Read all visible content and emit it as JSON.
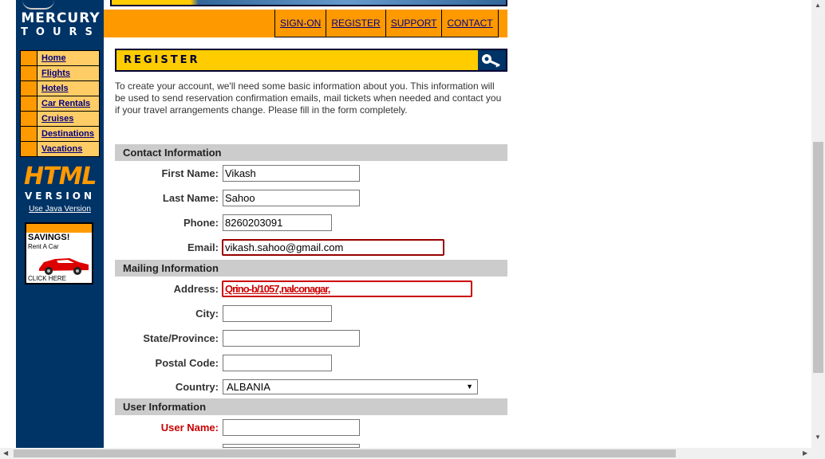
{
  "brand": {
    "line1": "MERCURY",
    "line2": "TOURS"
  },
  "nav": {
    "items": [
      "Home",
      "Flights",
      "Hotels",
      "Car Rentals",
      "Cruises",
      "Destinations",
      "Vacations"
    ]
  },
  "side": {
    "html_label": "HTML",
    "version_label": "VERSION",
    "java_link": "Use Java Version",
    "ad": {
      "title": "SAVINGS!",
      "subtitle": "Rent A Car",
      "cta": "CLICK HERE"
    }
  },
  "toplinks": [
    "SIGN-ON",
    "REGISTER",
    "SUPPORT",
    "CONTACT"
  ],
  "page": {
    "title": "REGISTER",
    "intro": "To create your account, we'll need some basic information about you. This information will be used to send reservation confirmation emails, mail tickets when needed and contact you if your travel arrangements change. Please fill in the form completely."
  },
  "sections": {
    "contact": "Contact Information",
    "mailing": "Mailing Information",
    "user": "User Information"
  },
  "form": {
    "first_name": {
      "label": "First Name:",
      "value": "Vikash"
    },
    "last_name": {
      "label": "Last Name:",
      "value": "Sahoo"
    },
    "phone": {
      "label": "Phone:",
      "value": "8260203091"
    },
    "email": {
      "label": "Email:",
      "value": "vikash.sahoo@gmail.com"
    },
    "address": {
      "label": "Address:",
      "value": "Qrino-b/1057,nalconagar,"
    },
    "city": {
      "label": "City:",
      "value": ""
    },
    "state": {
      "label": "State/Province:",
      "value": ""
    },
    "postal": {
      "label": "Postal Code:",
      "value": ""
    },
    "country": {
      "label": "Country:",
      "value": "ALBANIA"
    },
    "username": {
      "label": "User Name:",
      "value": ""
    }
  },
  "colors": {
    "sidebar": "#003366",
    "accent": "#ff9900",
    "title_bar": "#ffcc00",
    "section_bg": "#cccccc",
    "error": "#cc0000"
  }
}
